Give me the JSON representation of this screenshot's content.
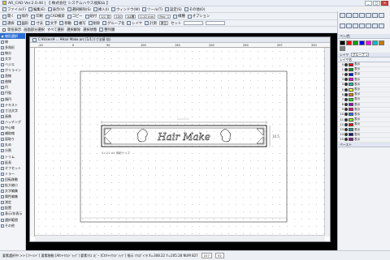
{
  "window": {
    "title": "AR_CAD Ver.2.0.40 | 【 株式会社 システムハウス福知山 】",
    "controls": [
      "_",
      "□",
      "×"
    ]
  },
  "menubar": {
    "items": [
      {
        "label": "ファイル(F)",
        "icon": "file-icon"
      },
      {
        "label": "編集(E)",
        "icon": "edit-icon"
      },
      {
        "label": "表示(V)",
        "icon": "view-icon"
      },
      {
        "label": "選択解除(S)",
        "icon": "deselect-icon"
      },
      {
        "label": "挿入(I)",
        "icon": "insert-icon"
      },
      {
        "label": "ウィンドウ(W)",
        "icon": "window-icon"
      },
      {
        "label": "ツール(T)",
        "icon": "tool-icon"
      },
      {
        "label": "設定(S)",
        "icon": "settings-icon"
      },
      {
        "label": "その他(O)",
        "icon": "other-icon"
      }
    ]
  },
  "toolbar2": {
    "items": [
      "開く",
      "保存",
      "印刷",
      "CAD検索",
      "コピー",
      "貼付",
      "一括",
      "用紙",
      "マウス"
    ],
    "zoom_value": "1/1 倍",
    "zoom2_value": "100",
    "paper_value": "A4横",
    "pen_label": "Pen: 1",
    "width_value": "0.10 mm",
    "line_label": "線種",
    "option_label": "オプション"
  },
  "toolbar3": {
    "items": [
      "選択",
      "図形",
      "寸法",
      "文字",
      "移動",
      "複写",
      "削除",
      "グループ化",
      "レイヤ",
      "計測"
    ],
    "mode_label": "セット",
    "mode_value": "単位",
    "field1": "",
    "field2": ""
  },
  "toolbar4": {
    "items": [
      "画面部分選択",
      "すべて選択",
      "選択解除",
      "選択状態",
      "整列順"
    ],
    "check_label": "等倍表示"
  },
  "left_panel": {
    "tools": [
      "線形選択",
      "線",
      "多角形",
      "線分",
      "文字",
      "ベジエ",
      "ポリライン",
      "直線",
      "曲線",
      "円",
      "円弧",
      "楕円",
      "テキスト",
      "寸法文字",
      "画像",
      "ハッチング",
      "中心線",
      "補助線",
      "面取り",
      "丸め",
      "分割",
      "トリム",
      "延長",
      "オフセット",
      "ミラー",
      "回転移動",
      "拡大縮小",
      "文字編集",
      "属性編集",
      "測定",
      "配置",
      "表示/非表示",
      "選択範囲",
      "その他"
    ],
    "active_index": 0
  },
  "document": {
    "title": "C:¥Users¥ ... ¥Hair Make.arc  [1/1]  (寸法値  倍)",
    "ruler_labels": [
      "-20",
      "0",
      "50",
      "100",
      "150",
      "200",
      "250",
      "297",
      "320"
    ],
    "sign_text": "Hair Make",
    "dim_text": "10.5",
    "scale_note": "S=1/1 A4 用紙サイズ"
  },
  "right_panel": {
    "tab1": "ペン/色",
    "tab2": "レイヤ",
    "tab3": "ペースト",
    "pen_colors": [
      "#000000",
      "#ff0000",
      "#00a000",
      "#0000ff",
      "#ff00ff",
      "#00c0c0",
      "#c08000",
      "#808080"
    ],
    "layers_header": "レイヤ名",
    "group_label": "グループ 1",
    "layers": [
      {
        "num": "0",
        "name": "表示",
        "color": "#ff0000"
      },
      {
        "num": "1",
        "name": "表示",
        "color": "#00a000"
      },
      {
        "num": "2",
        "name": "表示",
        "color": "#0000ff"
      },
      {
        "num": "3",
        "name": "表示",
        "color": "#ff00ff"
      },
      {
        "num": "4",
        "name": "表示",
        "color": "#00c0c0"
      },
      {
        "num": "5",
        "name": "表示",
        "color": "#ffff00"
      },
      {
        "num": "6",
        "name": "表示",
        "color": "#ff8000"
      },
      {
        "num": "7",
        "name": "表示",
        "color": "#00ff00"
      },
      {
        "num": "8",
        "name": "表示",
        "color": "#8000ff"
      },
      {
        "num": "9",
        "name": "表示",
        "color": "#ff0080"
      },
      {
        "num": "10",
        "name": "表示",
        "color": "#0080ff"
      },
      {
        "num": "11",
        "name": "表示",
        "color": "#80ff00"
      },
      {
        "num": "12",
        "name": "表示",
        "color": "#ff0000"
      },
      {
        "num": "13",
        "name": "表示",
        "color": "#00a0a0"
      },
      {
        "num": "14",
        "name": "表示",
        "color": "#0000a0"
      },
      {
        "num": "15",
        "name": "表示",
        "color": "#a000a0"
      }
    ]
  },
  "statusbar": {
    "text": "要素選択中 >> [ﾌﾘｰﾊﾝﾄﾞ] 要素移動 [Alt+ﾏｳｽﾄﾞﾗｯｸﾞ] 要素ﾏｳｽ ｺﾋﾟｰ [Ctrl+ﾏｳｽﾄﾞﾗｯｸﾞ] 指示 ﾏｳｽﾎﾟｲﾝﾀ X=308.22  Y=205.28  NUM  827",
    "box1": "227",
    "box2": "52"
  },
  "accent": "#2b6fd6"
}
